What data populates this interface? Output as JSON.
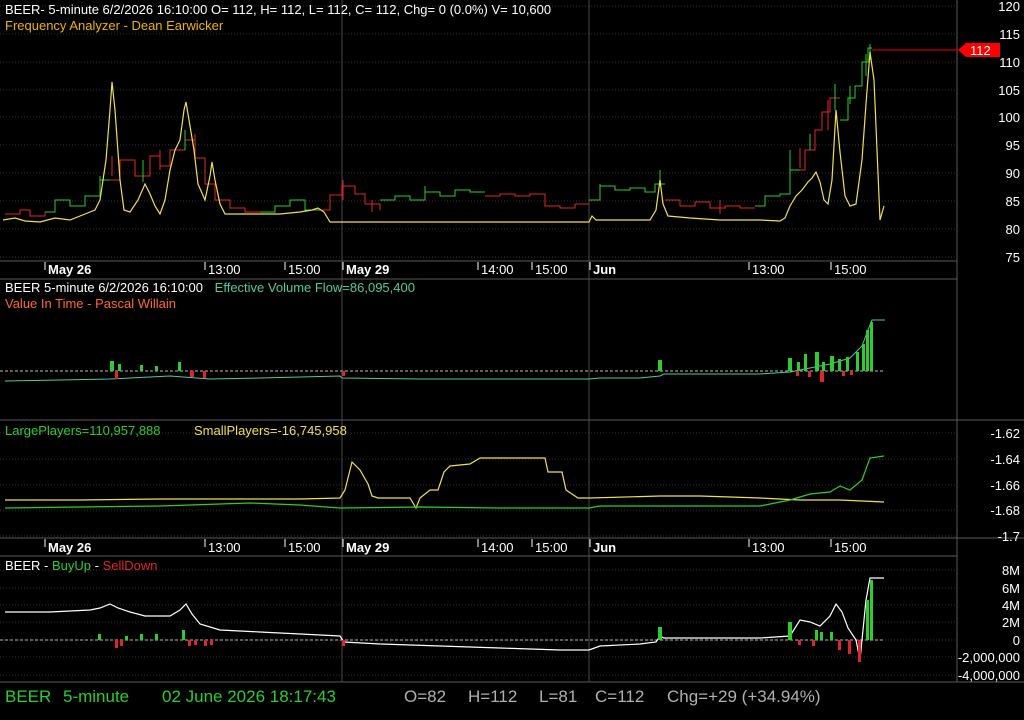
{
  "colors": {
    "up": "#2ecc2e",
    "down": "#e0242c",
    "yellow": "#f0e050",
    "orange": "#ff7a2a",
    "teal": "#4fc9a8",
    "white": "#ffffff",
    "grid": "#3a3a3a",
    "red_tag": "#ff0000"
  },
  "panel1": {
    "header": "BEER- 5-minute 6/2/2026 16:10:00 O= 112, H= 112, L= 112, C= 112, Chg= 0 (0.0%) V= 10,600",
    "subheader": "Frequency Analyzer - Dean Earwicker",
    "y_ticks": [
      "120",
      "115",
      "110",
      "105",
      "100",
      "95",
      "90",
      "85",
      "80",
      "75"
    ],
    "price_tag": "112"
  },
  "time_axis": {
    "labels": [
      {
        "text": "May 26",
        "bold": true
      },
      {
        "text": "13:00",
        "bold": false
      },
      {
        "text": "15:00",
        "bold": false
      },
      {
        "text": "May 29",
        "bold": true
      },
      {
        "text": "14:00",
        "bold": false
      },
      {
        "text": "15:00",
        "bold": false
      },
      {
        "text": "Jun",
        "bold": true
      },
      {
        "text": "13:00",
        "bold": false
      },
      {
        "text": "15:00",
        "bold": false
      }
    ]
  },
  "panel2": {
    "header_prefix": "BEER 5-minute  6/2/2026 16:10:00",
    "header_flow": "Effective Volume Flow=86,095,400",
    "subheader": "Value In Time - Pascal Willain"
  },
  "panel3": {
    "large": "LargePlayers=110,957,888",
    "small": "SmallPlayers=-16,745,958",
    "y_ticks": [
      "-1.62",
      "-1.64",
      "-1.66",
      "-1.68",
      "-1.7"
    ]
  },
  "panel4": {
    "title_ticker": "BEER - ",
    "title_buy": "BuyUp",
    "title_sep": "-",
    "title_sell": "SellDown",
    "y_ticks": [
      "8M",
      "6M",
      "4M",
      "2M",
      "0",
      "-2,000,000",
      "-4,000,000"
    ]
  },
  "footer": {
    "symbol": "BEER",
    "interval": "5-minute",
    "datetime": "02 June 2026 18:17:43",
    "open": "O=82",
    "high": "H=112",
    "low": "L=81",
    "close": "C=112",
    "change": "Chg=+29 (+34.94%)"
  }
}
